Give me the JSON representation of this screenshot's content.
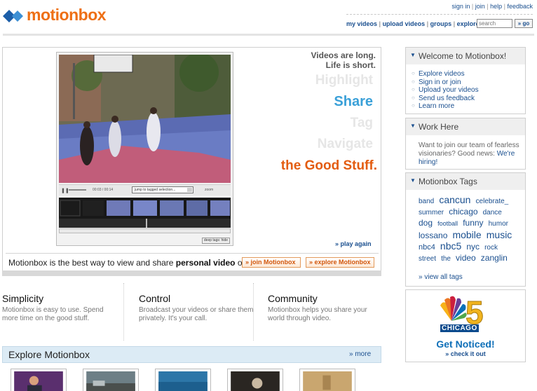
{
  "brand": {
    "name": "motionbox",
    "color": "#ee6f15"
  },
  "top_links": [
    "sign in",
    "join",
    "help",
    "feedback"
  ],
  "nav": {
    "items": [
      "my videos",
      "upload videos",
      "groups",
      "explore"
    ],
    "search_placeholder": "search",
    "go_label": "go"
  },
  "hero": {
    "tagline_1": "Videos are long.",
    "tagline_2": "Life is short.",
    "words": [
      "Highlight",
      "Share",
      "Tag",
      "Navigate",
      "the Good Stuff."
    ],
    "play_again": "play again",
    "promo_before": "Motionbox is the best way to view and share ",
    "promo_bold": "personal video",
    "promo_after": " online.",
    "join_label": "join Motionbox",
    "explore_label": "explore Motionbox",
    "player": {
      "time": "00:03 / 00:14",
      "jump_label": "jump to tagged selection...",
      "zoom_label": "zoom",
      "deep_tags_label": "deep tags: hide"
    }
  },
  "features": [
    {
      "title": "Simplicity",
      "desc": "Motionbox is easy to use. Spend more time on the good stuff."
    },
    {
      "title": "Control",
      "desc": "Broadcast your videos or share them privately. It's your call."
    },
    {
      "title": "Community",
      "desc": "Motionbox helps you share your world through video."
    }
  ],
  "explore": {
    "title": "Explore Motionbox",
    "more": "more"
  },
  "sidebar": {
    "welcome": {
      "title": "Welcome to Motionbox!",
      "items": [
        "Explore videos",
        "Sign in or join",
        "Upload your videos",
        "Send us feedback",
        "Learn more"
      ]
    },
    "work": {
      "title": "Work Here",
      "text": "Want to join our team of fearless visionaries? Good news: ",
      "link": "We're hiring!"
    },
    "tags": {
      "title": "Motionbox Tags",
      "cloud": [
        {
          "t": "band",
          "s": 10
        },
        {
          "t": "cancun",
          "s": 14
        },
        {
          "t": "celebrate_",
          "s": 10
        },
        {
          "t": "summer",
          "s": 10
        },
        {
          "t": "chicago",
          "s": 12
        },
        {
          "t": "dance",
          "s": 10
        },
        {
          "t": "dog",
          "s": 12
        },
        {
          "t": "football",
          "s": 9
        },
        {
          "t": "funny",
          "s": 12
        },
        {
          "t": "humor",
          "s": 10
        },
        {
          "t": "lossano",
          "s": 12
        },
        {
          "t": "mobile",
          "s": 14
        },
        {
          "t": "music",
          "s": 14
        },
        {
          "t": "nbc4",
          "s": 11
        },
        {
          "t": "nbc5",
          "s": 14
        },
        {
          "t": "nyc",
          "s": 12
        },
        {
          "t": "rock",
          "s": 10
        },
        {
          "t": "street",
          "s": 10
        },
        {
          "t": "the",
          "s": 10
        },
        {
          "t": "video",
          "s": 12
        },
        {
          "t": "zanglin",
          "s": 12
        }
      ],
      "view_all": "view all tags"
    },
    "ad": {
      "number": "5",
      "city": "CHICAGO",
      "headline": "Get Noticed!",
      "cta": "check it out"
    }
  }
}
